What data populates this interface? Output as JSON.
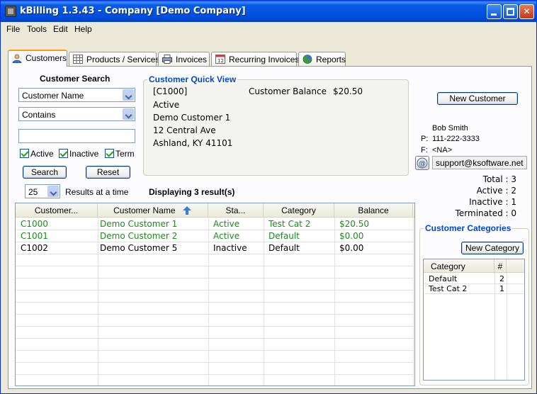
{
  "window": {
    "title": "kBilling 1.3.43 - Company [Demo Company]"
  },
  "menu": [
    "File",
    "Tools",
    "Edit",
    "Help"
  ],
  "tabs": [
    {
      "label": "Customers",
      "icon": "person-icon",
      "active": true
    },
    {
      "label": "Products / Services",
      "icon": "grid-icon"
    },
    {
      "label": "Invoices",
      "icon": "printer-icon"
    },
    {
      "label": "Recurring Invoices",
      "icon": "calendar-icon"
    },
    {
      "label": "Reports",
      "icon": "pie-chart-icon"
    }
  ],
  "search": {
    "title": "Customer Search",
    "field": "Customer Name",
    "operator": "Contains",
    "query": "",
    "filters": {
      "active": "Active",
      "inactive": "Inactive",
      "term": "Term"
    },
    "search_button": "Search",
    "reset_button": "Reset",
    "page_size": "25",
    "page_size_label": "Results at a time"
  },
  "quick_view": {
    "title": "Customer Quick View",
    "id": "[C1000]",
    "balance_label": "Customer Balance",
    "balance": "$20.50",
    "status": "Active",
    "name": "Demo Customer 1",
    "address1": "12 Central Ave",
    "address2": "Ashland, KY 41101"
  },
  "contact": {
    "new_customer_button": "New Customer",
    "name": "Bob Smith",
    "phone_label": "P:",
    "phone": "111-222-3333",
    "fax_label": "F:",
    "fax": "<NA>",
    "email": "support@ksoftware.net"
  },
  "stats": {
    "total": "Total : 3",
    "active": "Active : 2",
    "inactive": "Inactive : 1",
    "terminated": "Terminated : 0"
  },
  "results": {
    "summary": "Displaying 3 result(s)",
    "columns": [
      "Customer...",
      "Customer Name",
      "Sta...",
      "Category",
      "Balance"
    ],
    "rows": [
      [
        "C1000",
        "Demo Customer 1",
        "Active",
        "Test Cat 2",
        "$20.50"
      ],
      [
        "C1001",
        "Demo Customer 2",
        "Active",
        "Default",
        "$0.00"
      ],
      [
        "C1002",
        "Demo Customer 5",
        "Inactive",
        "Default",
        "$0.00"
      ]
    ]
  },
  "categories": {
    "title": "Customer Categories",
    "new_button": "New Category",
    "columns": [
      "Category",
      "#"
    ],
    "rows": [
      [
        "Default",
        "2"
      ],
      [
        "Test Cat 2",
        "1"
      ]
    ]
  },
  "colors": {
    "active_row": "#1e8a1e",
    "group_title": "#0046d5",
    "titlebar": "#0050e0"
  }
}
